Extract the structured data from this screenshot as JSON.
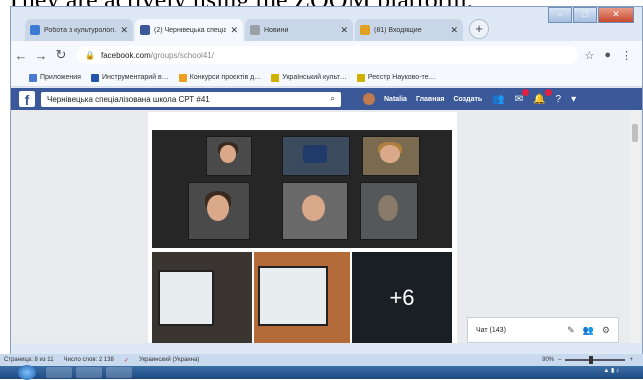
{
  "caption": "They are actively using the ZOOM platform.",
  "browser": {
    "tabs": [
      {
        "label": "Робота з культурологі…",
        "color": "#3b7bd4",
        "active": false
      },
      {
        "label": "(2) Чернівецька спеціал…",
        "color": "#3b5998",
        "active": true
      },
      {
        "label": "Новини",
        "color": "#9aa0a6",
        "active": false
      },
      {
        "label": "(81) Входящие",
        "color": "#e0a020",
        "active": false
      }
    ],
    "new_tab": "+",
    "url_host": "facebook.com",
    "url_path": "/groups/school41/",
    "bookmarks": [
      {
        "label": "Приложения",
        "color": "#4a7bd0"
      },
      {
        "label": "Инструментарий в…",
        "color": "#2255aa"
      },
      {
        "label": "Конкурси проєктів д…",
        "color": "#f0a020"
      },
      {
        "label": "Український культ…",
        "color": "#d2b000"
      },
      {
        "label": "Реєстр Науково-те…",
        "color": "#d2b000"
      }
    ]
  },
  "facebook": {
    "search_text": "Чернівецька спеціалізована школа СРТ #41",
    "user_name": "Natalia",
    "nav_home": "Главная",
    "nav_create": "Создать",
    "accent": "#3b5998"
  },
  "post": {
    "more_photos": "+6"
  },
  "chat": {
    "label": "Чат (143)"
  },
  "word_status": {
    "page": "Страница: 8 из 11",
    "words": "Число слов: 2 138",
    "language": "Украинский (Украина)",
    "zoom": "90%"
  }
}
